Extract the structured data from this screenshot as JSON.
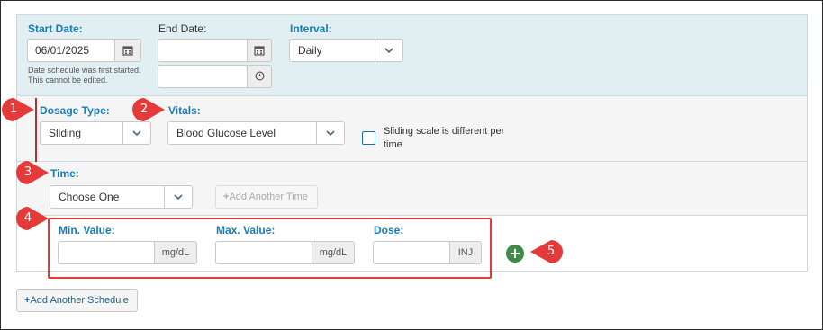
{
  "schedule": {
    "start_date_label": "Start Date:",
    "start_date_value": "06/01/2025",
    "start_note_line1": "Date schedule was first started.",
    "start_note_line2": "This cannot be edited.",
    "end_date_label": "End Date:",
    "end_date_value": "",
    "end_time_value": "",
    "interval_label": "Interval:",
    "interval_value": "Daily",
    "icons": {
      "calendar": "calendar-icon",
      "clock": "clock-icon",
      "chevron": "chevron-down-icon"
    }
  },
  "dosage": {
    "dosage_type_label": "Dosage Type:",
    "dosage_type_value": "Sliding",
    "vitals_label": "Vitals:",
    "vitals_value": "Blood Glucose Level",
    "sliding_checkbox_line1": "Sliding scale is different per",
    "sliding_checkbox_line2": "time",
    "sliding_checkbox_checked": false
  },
  "time": {
    "label": "Time:",
    "value": "Choose One",
    "add_time_label": "Add Another Time"
  },
  "range": {
    "min_label": "Min. Value:",
    "min_value": "",
    "min_unit": "mg/dL",
    "max_label": "Max. Value:",
    "max_value": "",
    "max_unit": "mg/dL",
    "dose_label": "Dose:",
    "dose_value": "",
    "dose_unit": "INJ"
  },
  "add_schedule_label": "Add Another Schedule",
  "markers": [
    "1",
    "2",
    "3",
    "4",
    "5"
  ],
  "colors": {
    "accent": "#1b7ab5",
    "highlight": "#e03c3c",
    "add": "#3f8a46",
    "panel_blue": "#e1eef2"
  }
}
